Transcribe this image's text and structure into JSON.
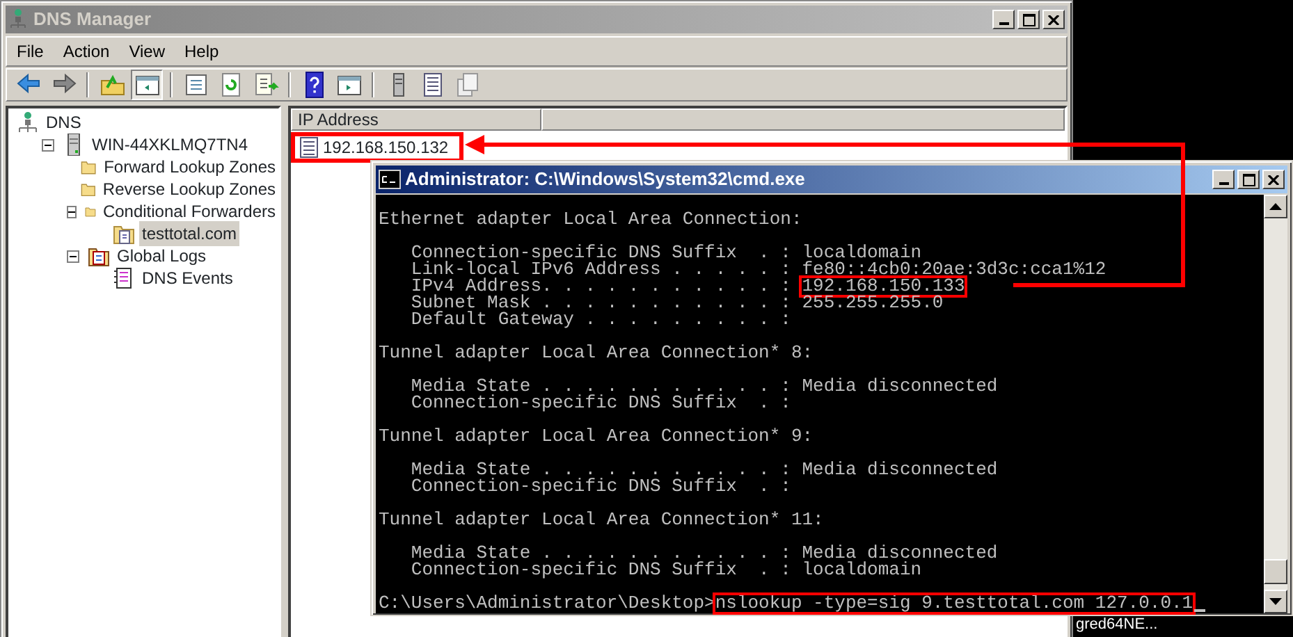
{
  "dns_manager": {
    "title": "DNS Manager",
    "menu": [
      "File",
      "Action",
      "View",
      "Help"
    ],
    "toolbar": [
      {
        "kind": "back",
        "on": false
      },
      {
        "kind": "forward",
        "on": false
      },
      {
        "kind": "sep"
      },
      {
        "kind": "up",
        "on": false
      },
      {
        "kind": "tree",
        "on": true
      },
      {
        "kind": "sep"
      },
      {
        "kind": "properties",
        "on": false
      },
      {
        "kind": "refresh",
        "on": false
      },
      {
        "kind": "export",
        "on": false
      },
      {
        "kind": "sep"
      },
      {
        "kind": "help",
        "on": false
      },
      {
        "kind": "pane",
        "on": false
      },
      {
        "kind": "sep"
      },
      {
        "kind": "server",
        "on": false
      },
      {
        "kind": "list",
        "on": false
      },
      {
        "kind": "copy",
        "on": false
      }
    ],
    "tree": [
      {
        "label": "DNS",
        "kind": "root",
        "selected": false,
        "children": [
          {
            "label": "WIN-44XKLMQ7TN4",
            "kind": "server",
            "selected": false,
            "expanded": true,
            "children": [
              {
                "label": "Forward Lookup Zones",
                "kind": "folder",
                "selected": false
              },
              {
                "label": "Reverse Lookup Zones",
                "kind": "folder",
                "selected": false
              },
              {
                "label": "Conditional Forwarders",
                "kind": "folder",
                "selected": false,
                "expanded": true,
                "children": [
                  {
                    "label": "testtotal.com",
                    "kind": "zone",
                    "selected": true
                  }
                ]
              },
              {
                "label": "Global Logs",
                "kind": "logs",
                "selected": false,
                "expanded": true,
                "children": [
                  {
                    "label": "DNS Events",
                    "kind": "log",
                    "selected": false
                  }
                ]
              }
            ]
          }
        ]
      }
    ],
    "list": {
      "columns": [
        "IP Address"
      ],
      "rows": [
        {
          "cells": [
            "192.168.150.132"
          ],
          "highlighted": true
        }
      ]
    }
  },
  "cmd": {
    "title": "Administrator: C:\\Windows\\System32\\cmd.exe",
    "sections": [
      {
        "heading": "Ethernet adapter Local Area Connection:",
        "lines": [
          "   Connection-specific DNS Suffix  . : localdomain",
          "   Link-local IPv6 Address . . . . . : fe80::4cb0:20ae:3d3c:cca1%12",
          {
            "label": "   IPv4 Address. . . . . . . . . . . : ",
            "value": "192.168.150.133",
            "highlighted": true
          },
          "   Subnet Mask . . . . . . . . . . . : 255.255.255.0",
          "   Default Gateway . . . . . . . . . :"
        ]
      },
      {
        "heading": "Tunnel adapter Local Area Connection* 8:",
        "lines": [
          "   Media State . . . . . . . . . . . : Media disconnected",
          "   Connection-specific DNS Suffix  . :"
        ]
      },
      {
        "heading": "Tunnel adapter Local Area Connection* 9:",
        "lines": [
          "   Media State . . . . . . . . . . . : Media disconnected",
          "   Connection-specific DNS Suffix  . :"
        ]
      },
      {
        "heading": "Tunnel adapter Local Area Connection* 11:",
        "lines": [
          "   Media State . . . . . . . . . . . : Media disconnected",
          "   Connection-specific DNS Suffix  . : localdomain"
        ]
      }
    ],
    "prompt": "C:\\Users\\Administrator\\Desktop>",
    "command": "nslookup -type=sig 9.testtotal.com 127.0.0.1",
    "command_highlighted": true
  },
  "desktop_label": "gred64NE..."
}
